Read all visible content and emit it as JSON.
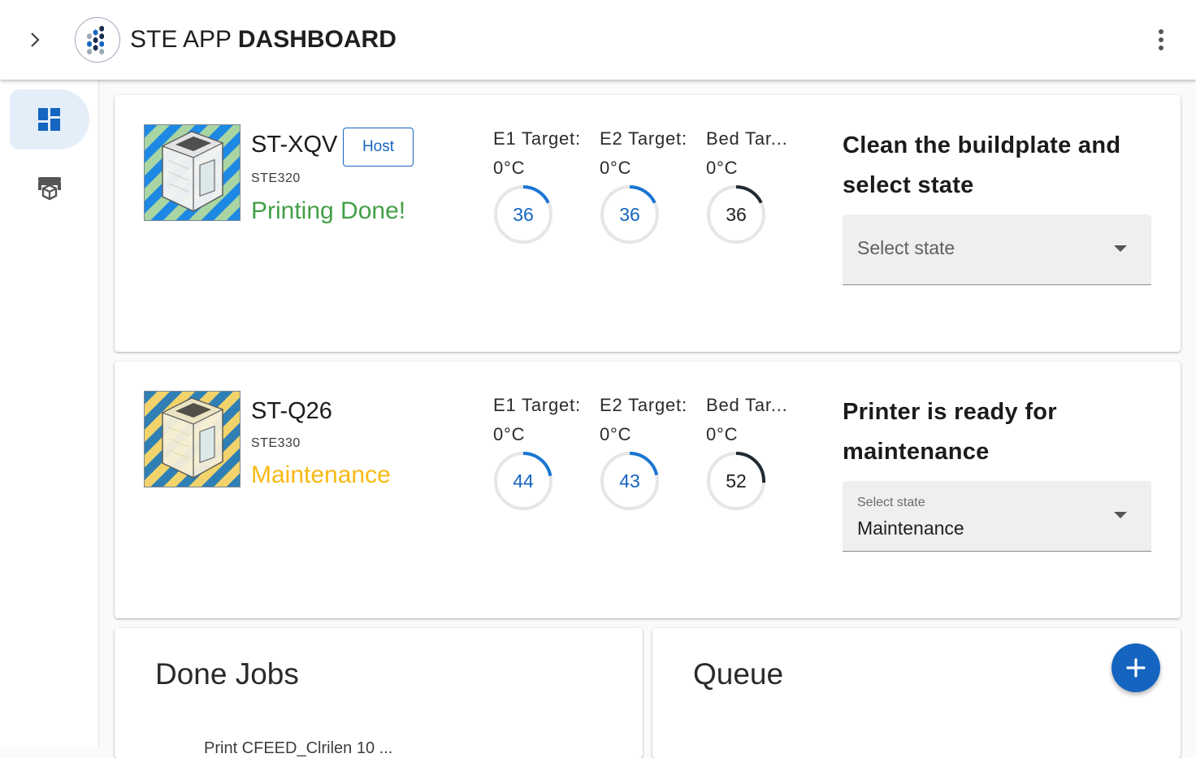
{
  "app": {
    "title_light": "STE APP ",
    "title_bold": "DASHBOARD"
  },
  "header": {
    "toggle_icon": "chevron-right-icon",
    "more_icon": "more-vertical-icon",
    "logo_icon": "hexagon-cluster-logo"
  },
  "sidenav": {
    "items": [
      {
        "icon": "dashboard-icon",
        "active": true
      },
      {
        "icon": "printer-cube-icon",
        "active": false
      }
    ]
  },
  "printers": [
    {
      "name": "ST-XQV",
      "host_label": "Host",
      "model": "STE320",
      "status": "Printing Done!",
      "status_color": "#43a047",
      "stripe_color": "#a8d5a2",
      "temps": [
        {
          "label": "E1 Target:",
          "target": "0°C",
          "current": "36",
          "current_value": 36,
          "style": "blue"
        },
        {
          "label": "E2 Target:",
          "target": "0°C",
          "current": "36",
          "current_value": 36,
          "style": "blue"
        },
        {
          "label": "Bed Tar...",
          "target": "0°C",
          "current": "36",
          "current_value": 36,
          "style": "dark"
        }
      ],
      "instruction": "Clean the buildplate and select state",
      "select": {
        "placeholder": "Select state",
        "label": "",
        "value": ""
      }
    },
    {
      "name": "ST-Q26",
      "host_label": "",
      "model": "STE330",
      "status": "Maintenance",
      "status_color": "#f9b912",
      "stripe_color": "#f2d36b",
      "temps": [
        {
          "label": "E1 Target:",
          "target": "0°C",
          "current": "44",
          "current_value": 44,
          "style": "blue"
        },
        {
          "label": "E2 Target:",
          "target": "0°C",
          "current": "43",
          "current_value": 43,
          "style": "blue"
        },
        {
          "label": "Bed Tar...",
          "target": "0°C",
          "current": "52",
          "current_value": 52,
          "style": "dark"
        }
      ],
      "instruction": "Printer is ready for maintenance",
      "select": {
        "placeholder": "",
        "label": "Select state",
        "value": "Maintenance"
      }
    }
  ],
  "done_jobs": {
    "title": "Done Jobs",
    "peek": "Print CFEED_Clrilen 10 ..."
  },
  "queue": {
    "title": "Queue",
    "add_icon": "plus-icon"
  },
  "colors": {
    "accent": "#1565c0",
    "nav_active_bg": "#e3eef8"
  }
}
